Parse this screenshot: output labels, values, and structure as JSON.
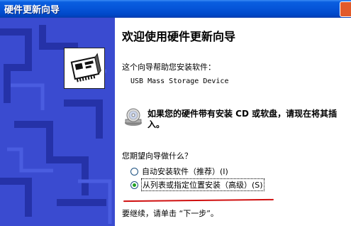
{
  "window": {
    "title": "硬件更新向导"
  },
  "wizard": {
    "heading": "欢迎使用硬件更新向导",
    "intro": "这个向导帮助您安装软件：",
    "device_name": "USB Mass Storage Device",
    "cd_notice": "如果您的硬件带有安装 CD 或软盘，请现在将其插入。",
    "question": "您期望向导做什么？",
    "options": [
      {
        "label": "自动安装软件（推荐）(I)",
        "selected": false
      },
      {
        "label": "从列表或指定位置安装（高级）(S)",
        "selected": true
      }
    ],
    "continue_text": "要继续，请单击 “下一步”。"
  },
  "icons": {
    "hardware": "hardware-board-icon",
    "cd": "cd-disk-icon",
    "close": "close-icon"
  },
  "colors": {
    "titlebar": "#0554d8",
    "sidebar": "#3a4bd0",
    "annotation_underline": "#d01010",
    "radio_selected": "#21a121"
  }
}
